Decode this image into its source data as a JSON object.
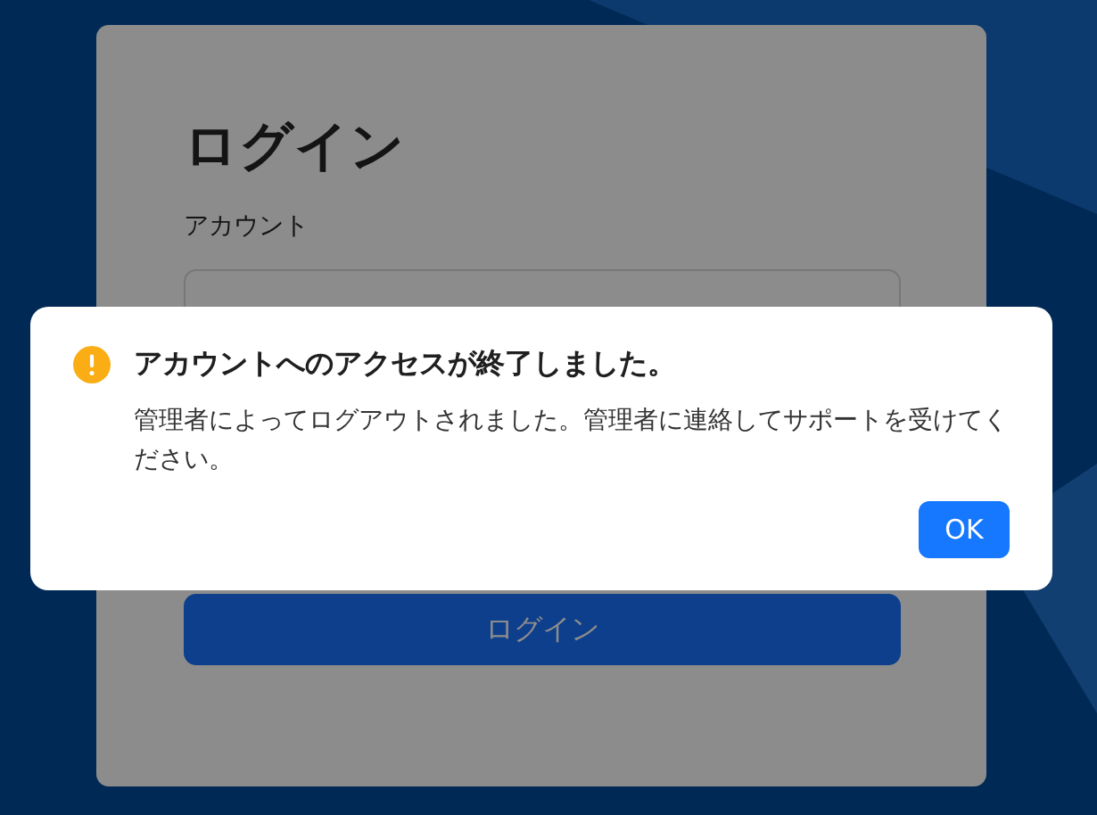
{
  "login_card": {
    "title": "ログイン",
    "account_label": "アカウント",
    "login_button": "ログイン"
  },
  "dialog": {
    "kind": "warning",
    "title": "アカウントへのアクセスが終了しました。",
    "message": "管理者によってログアウトされました。管理者に連絡してサポートを受けてください。",
    "buttons": [
      "OK"
    ]
  }
}
